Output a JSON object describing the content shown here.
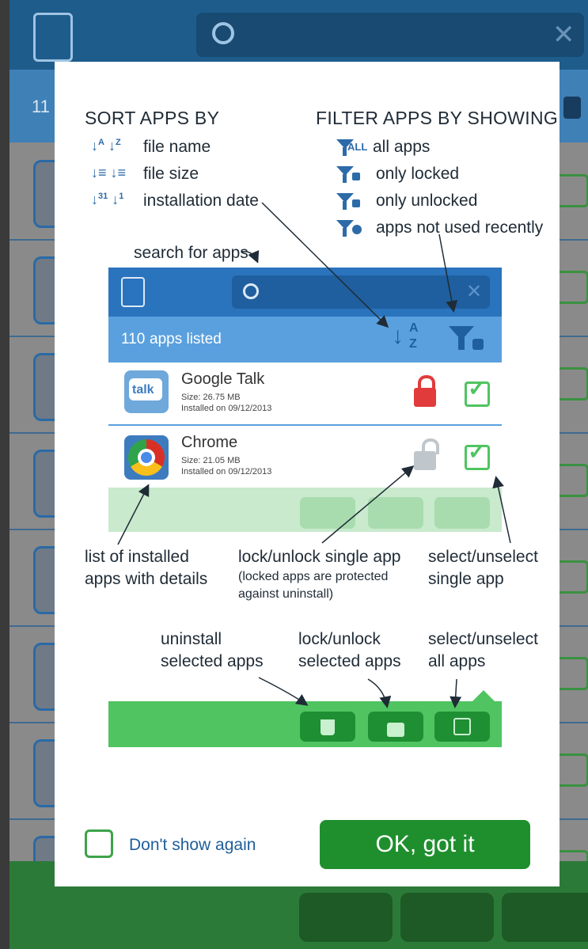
{
  "background_app": {
    "apps_count_partial": "11",
    "colors": {
      "top_bar": "#1e5c8c",
      "sub_bar": "#3f80b7",
      "bottom_bar": "#2c7a38"
    }
  },
  "dialog": {
    "sort": {
      "heading": "SORT APPS BY",
      "items": [
        {
          "icon": "sort-name-icon",
          "label": "file name"
        },
        {
          "icon": "sort-size-icon",
          "label": "file size"
        },
        {
          "icon": "sort-date-icon",
          "label": "installation date"
        }
      ]
    },
    "filter": {
      "heading": "FILTER APPS BY SHOWING",
      "items": [
        {
          "icon": "filter-all-icon",
          "label": "all apps",
          "icon_text": "ALL"
        },
        {
          "icon": "filter-locked-icon",
          "label": "only locked"
        },
        {
          "icon": "filter-unlocked-icon",
          "label": "only unlocked"
        },
        {
          "icon": "filter-unused-icon",
          "label": "apps not used recently"
        }
      ]
    },
    "annotations": {
      "search": "search for apps",
      "list_line1": "list of installed",
      "list_line2": "apps with details",
      "lock_single": "lock/unlock single app",
      "lock_note_line1": "(locked apps are protected",
      "lock_note_line2": "against uninstall)",
      "select_single_line1": "select/unselect",
      "select_single_line2": "single app",
      "uninstall_line1": "uninstall",
      "uninstall_line2": "selected apps",
      "lock_selected_line1": "lock/unlock",
      "lock_selected_line2": "selected apps",
      "select_all_line1": "select/unselect",
      "select_all_line2": "all apps"
    },
    "mini_app": {
      "apps_listed_count": "110",
      "apps_listed_label": "apps listed",
      "sort_letters": [
        "A",
        "Z"
      ],
      "apps": [
        {
          "name": "Google Talk",
          "icon_text": "talk",
          "size": "Size: 26.75 MB",
          "installed": "Installed on 09/12/2013",
          "locked": true,
          "selected": true
        },
        {
          "name": "Chrome",
          "size": "Size: 21.05 MB",
          "installed": "Installed on 09/12/2013",
          "locked": false,
          "selected": true
        }
      ]
    },
    "dont_show_label": "Don't show again",
    "ok_label": "OK, got it"
  }
}
